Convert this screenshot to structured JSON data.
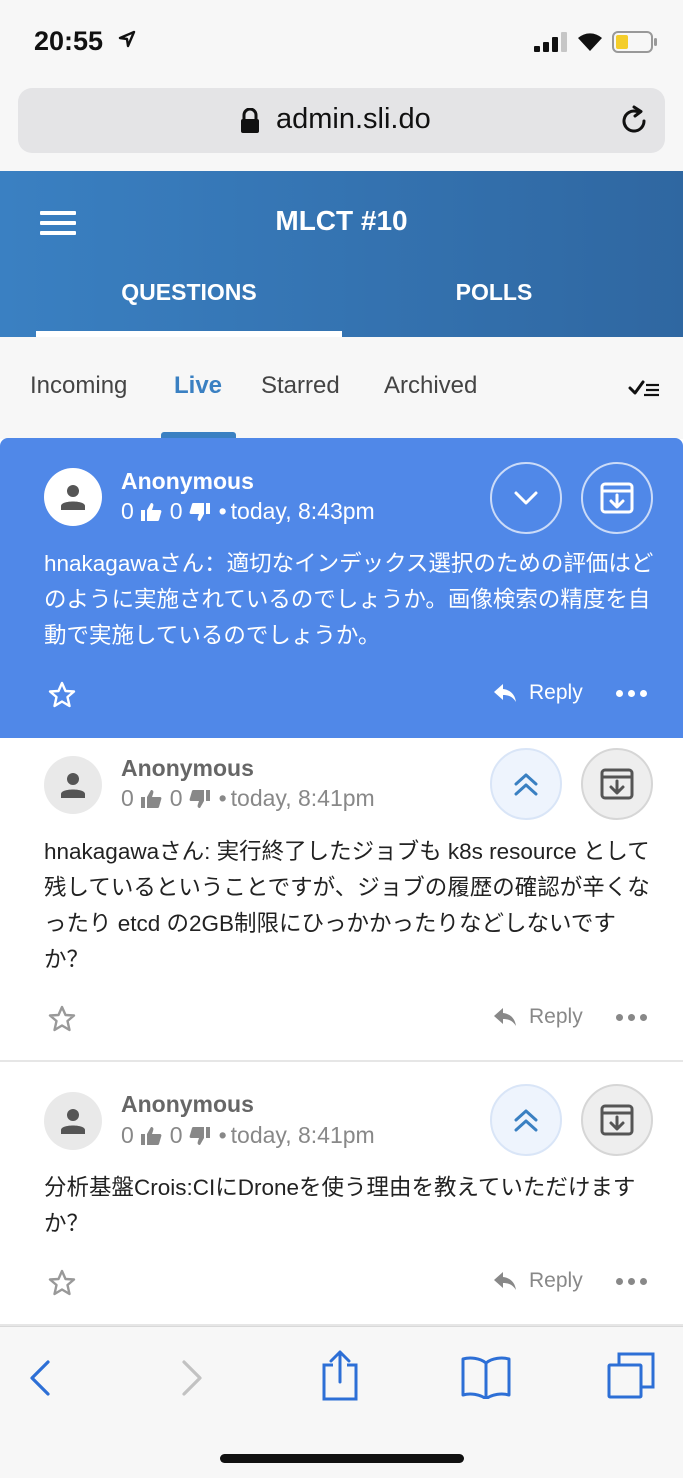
{
  "status_bar": {
    "time": "20:55"
  },
  "browser": {
    "url": "admin.sli.do"
  },
  "header": {
    "title": "MLCT #10",
    "tabs": [
      {
        "label": "QUESTIONS"
      },
      {
        "label": "POLLS"
      }
    ]
  },
  "filters": {
    "items": [
      {
        "label": "Incoming"
      },
      {
        "label": "Live"
      },
      {
        "label": "Starred"
      },
      {
        "label": "Archived"
      }
    ],
    "active": "Live"
  },
  "questions": [
    {
      "author": "Anonymous",
      "likes": "0",
      "dislikes": "0",
      "time": "today, 8:43pm",
      "text": "hnakagawaさん：適切なインデックス選択のための評価はどのように実施されているのでしょうか。画像検索の精度を自動で実施しているのでしょうか。",
      "reply_label": "Reply",
      "highlighted": true
    },
    {
      "author": "Anonymous",
      "likes": "0",
      "dislikes": "0",
      "time": "today, 8:41pm",
      "text": "hnakagawaさん: 実行終了したジョブも k8s resource として残しているということですが、ジョブの履歴の確認が辛くなったり etcd の2GB制限にひっかかったりなどしないですか？",
      "reply_label": "Reply",
      "highlighted": false
    },
    {
      "author": "Anonymous",
      "likes": "0",
      "dislikes": "0",
      "time": "today, 8:41pm",
      "text": "分析基盤Crois:CIにDroneを使う理由を教えていただけますか？",
      "reply_label": "Reply",
      "highlighted": false
    }
  ],
  "colors": {
    "accent": "#3a80c2",
    "highlight_card": "#5088e8",
    "header_gradient_start": "#3a80c2",
    "header_gradient_end": "#2f67a1"
  },
  "icons": {
    "status": [
      "location-arrow-icon",
      "signal-icon",
      "wifi-icon",
      "battery-icon"
    ],
    "browser": [
      "lock-icon",
      "reload-icon"
    ],
    "card": [
      "avatar-person-icon",
      "thumbs-up-icon",
      "thumbs-down-icon",
      "chevron-down-icon",
      "double-chevron-up-icon",
      "archive-icon",
      "star-icon",
      "reply-icon",
      "more-icon"
    ],
    "toolbar": [
      "back-icon",
      "forward-icon",
      "share-icon",
      "bookmarks-icon",
      "tabs-icon"
    ]
  }
}
